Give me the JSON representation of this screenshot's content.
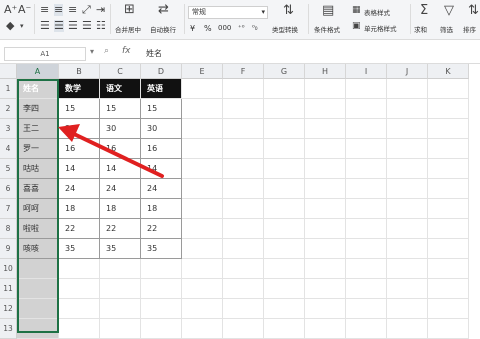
{
  "ribbon": {
    "font_size_up_icon": "A⁺",
    "font_size_down_icon": "A⁻",
    "merge_label": "合并居中",
    "wrap_label": "自动换行",
    "number_format": "常规",
    "type_convert_label": "类型转换",
    "cond_format_label": "条件格式",
    "table_style_label": "表格样式",
    "cell_style_label": "单元格样式",
    "sum_label": "求和",
    "filter_label": "筛选",
    "sort_label": "排序",
    "currency_symbol": "¥",
    "percent_symbol": "%",
    "thousands_symbol": "000"
  },
  "formula_bar": {
    "cell_ref": "A1",
    "fx": "fx",
    "content": "姓名"
  },
  "columns": [
    "A",
    "B",
    "C",
    "D",
    "E",
    "F",
    "G",
    "H",
    "I",
    "J",
    "K"
  ],
  "rows": [
    "1",
    "2",
    "3",
    "4",
    "5",
    "6",
    "7",
    "8",
    "9",
    "10",
    "11",
    "12",
    "13"
  ],
  "table": {
    "headers": [
      "姓名",
      "数学",
      "语文",
      "英语"
    ],
    "data": [
      [
        "李四",
        "15",
        "15",
        "15"
      ],
      [
        "王二",
        "30",
        "30",
        "30"
      ],
      [
        "罗一",
        "16",
        "16",
        "16"
      ],
      [
        "咕咕",
        "14",
        "14",
        "14"
      ],
      [
        "喜喜",
        "24",
        "24",
        "24"
      ],
      [
        "呵呵",
        "18",
        "18",
        "18"
      ],
      [
        "啦啦",
        "22",
        "22",
        "22"
      ],
      [
        "咳咳",
        "35",
        "35",
        "35"
      ]
    ]
  },
  "colors": {
    "header_bg": "#111111",
    "selected_col": "#d2d2d2",
    "selection_border": "#1e7145",
    "arrow": "#e02020"
  }
}
